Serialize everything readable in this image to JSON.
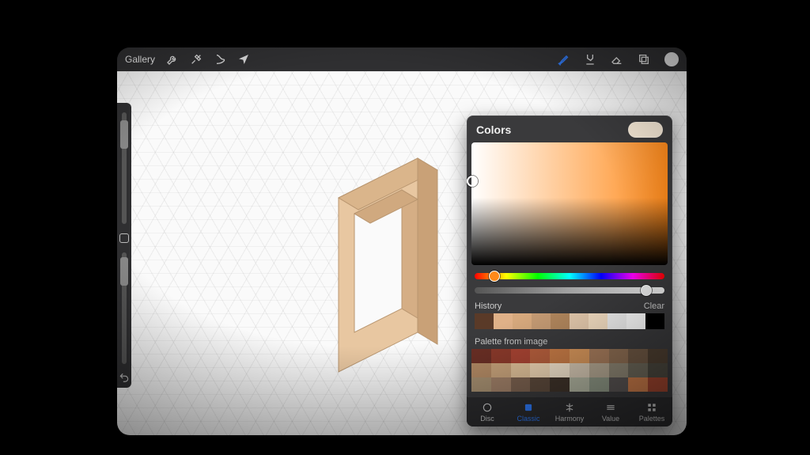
{
  "toolbar": {
    "gallery_label": "Gallery"
  },
  "popover": {
    "title": "Colors",
    "hue_value_pct": 8,
    "sat_value_pct": 88
  },
  "history": {
    "label": "History",
    "clear_label": "Clear",
    "colors": [
      "#5a3a28",
      "#e0b188",
      "#d7a97d",
      "#c59b74",
      "#b2875d",
      "#e6cbae",
      "#f6e0c4",
      "#f2f2f2",
      "#ffffff",
      "#000000"
    ]
  },
  "palette": {
    "label": "Palette from image",
    "colors": [
      "#6b2f25",
      "#8c3a2b",
      "#a94433",
      "#b65f3d",
      "#c77b46",
      "#d7965b",
      "#a77c5c",
      "#8e6e53",
      "#6f5844",
      "#4e3f31",
      "#b58c66",
      "#c9a47c",
      "#e1c29a",
      "#f0d7b6",
      "#f5e6cf",
      "#d6c8b4",
      "#b6a994",
      "#8f8775",
      "#6d685a",
      "#4b483f",
      "#a89172",
      "#a08068",
      "#7c6250",
      "#5d4a3c",
      "#3f332a",
      "#b2b5a1",
      "#8f9886",
      "#5a5554",
      "#cc7c4a",
      "#a0452f"
    ]
  },
  "tabs": {
    "disc": "Disc",
    "classic": "Classic",
    "harmony": "Harmony",
    "value": "Value",
    "palettes": "Palettes"
  }
}
